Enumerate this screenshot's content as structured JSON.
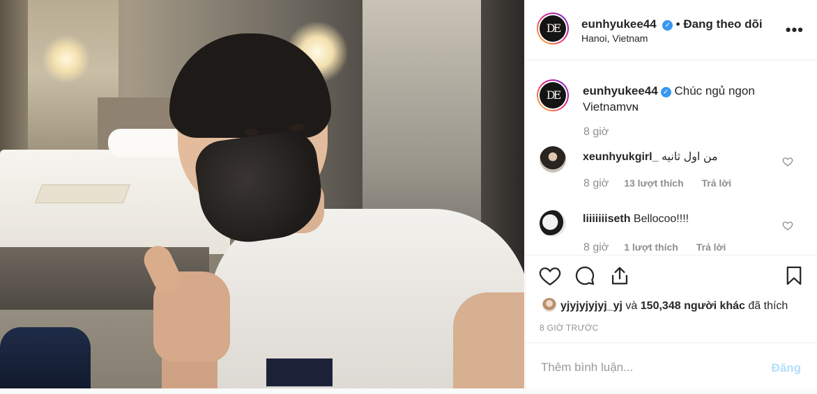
{
  "post": {
    "username": "eunhyukee44",
    "verified": true,
    "follow_status": "• Đang theo dõi",
    "location": "Hanoi, Vietnam",
    "avatar_logo": "DE",
    "more_icon": "more-horizontal-icon",
    "caption": {
      "username": "eunhyukee44",
      "text": "Chúc ngủ ngon Vietnamᴠɴ",
      "time": "8 giờ"
    },
    "comments": [
      {
        "username": "xeunhyukgirl_",
        "text": "من اول ثانيه",
        "time": "8 giờ",
        "likes": "13 lượt thích",
        "reply": "Trả lời"
      },
      {
        "username": "liiiiiiiseth",
        "text": "Bellocoo!!!!",
        "time": "8 giờ",
        "likes": "1 lượt thích",
        "reply": "Trả lời"
      }
    ],
    "actions": {
      "like_icon": "heart-icon",
      "comment_icon": "comment-icon",
      "share_icon": "share-icon",
      "save_icon": "bookmark-icon"
    },
    "likes_summary": {
      "first_user": "yjyjyjyjyj_yj",
      "connector": "và",
      "others": "150,348 người khác",
      "suffix": "đã thích"
    },
    "post_time": "8 GIỜ TRƯỚC",
    "add_comment": {
      "placeholder": "Thêm bình luận...",
      "post_label": "Đăng"
    }
  },
  "colors": {
    "accent_blue": "#3897f0",
    "post_button_disabled": "#b2dffc",
    "secondary_text": "#8e8e8e",
    "primary_text": "#262626"
  }
}
